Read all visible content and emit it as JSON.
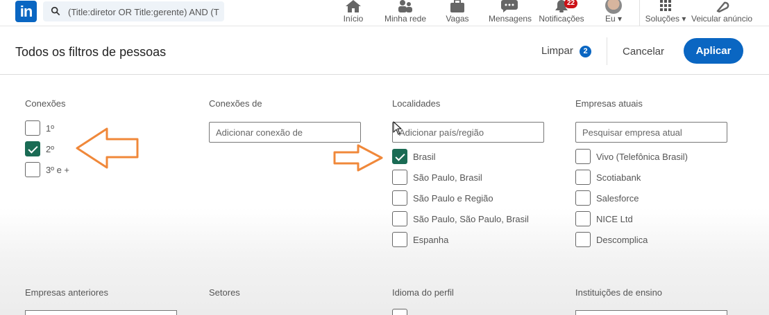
{
  "nav": {
    "logo_text": "in",
    "search_value": "(Title:diretor OR Title:gerente) AND (T",
    "items": [
      {
        "label": "Início",
        "icon": "home-icon"
      },
      {
        "label": "Minha rede",
        "icon": "network-icon"
      },
      {
        "label": "Vagas",
        "icon": "briefcase-icon"
      },
      {
        "label": "Mensagens",
        "icon": "message-icon"
      },
      {
        "label": "Notificações",
        "icon": "bell-icon",
        "badge": "22"
      },
      {
        "label": "Eu",
        "icon": "avatar"
      },
      {
        "label": "Soluções",
        "icon": "grid-icon"
      },
      {
        "label": "Veicular anúncio",
        "icon": "megaphone-icon"
      }
    ]
  },
  "header": {
    "title": "Todos os filtros de pessoas",
    "clear_label": "Limpar",
    "clear_count": "2",
    "cancel_label": "Cancelar",
    "apply_label": "Aplicar"
  },
  "filters": {
    "connections": {
      "label": "Conexões",
      "options": [
        {
          "label": "1º",
          "checked": false
        },
        {
          "label": "2º",
          "checked": true
        },
        {
          "label": "3º e +",
          "checked": false
        }
      ]
    },
    "connections_of": {
      "label": "Conexões de",
      "placeholder": "Adicionar conexão de"
    },
    "locations": {
      "label": "Localidades",
      "placeholder": "Adicionar país/região",
      "options": [
        {
          "label": "Brasil",
          "checked": true
        },
        {
          "label": "São Paulo, Brasil",
          "checked": false
        },
        {
          "label": "São Paulo e Região",
          "checked": false
        },
        {
          "label": "São Paulo, São Paulo, Brasil",
          "checked": false
        },
        {
          "label": "Espanha",
          "checked": false
        }
      ]
    },
    "current_companies": {
      "label": "Empresas atuais",
      "placeholder": "Pesquisar empresa atual",
      "options": [
        {
          "label": "Vivo (Telefônica Brasil)",
          "checked": false
        },
        {
          "label": "Scotiabank",
          "checked": false
        },
        {
          "label": "Salesforce",
          "checked": false
        },
        {
          "label": "NICE Ltd",
          "checked": false
        },
        {
          "label": "Descomplica",
          "checked": false
        }
      ]
    },
    "past_companies": {
      "label": "Empresas anteriores"
    },
    "industries": {
      "label": "Setores"
    },
    "profile_language": {
      "label": "Idioma do perfil"
    },
    "schools": {
      "label": "Instituições de ensino"
    }
  },
  "colors": {
    "brand": "#0a66c2",
    "checked": "#1a6b54",
    "arrow": "#f0883a",
    "badge": "#cc1016"
  }
}
